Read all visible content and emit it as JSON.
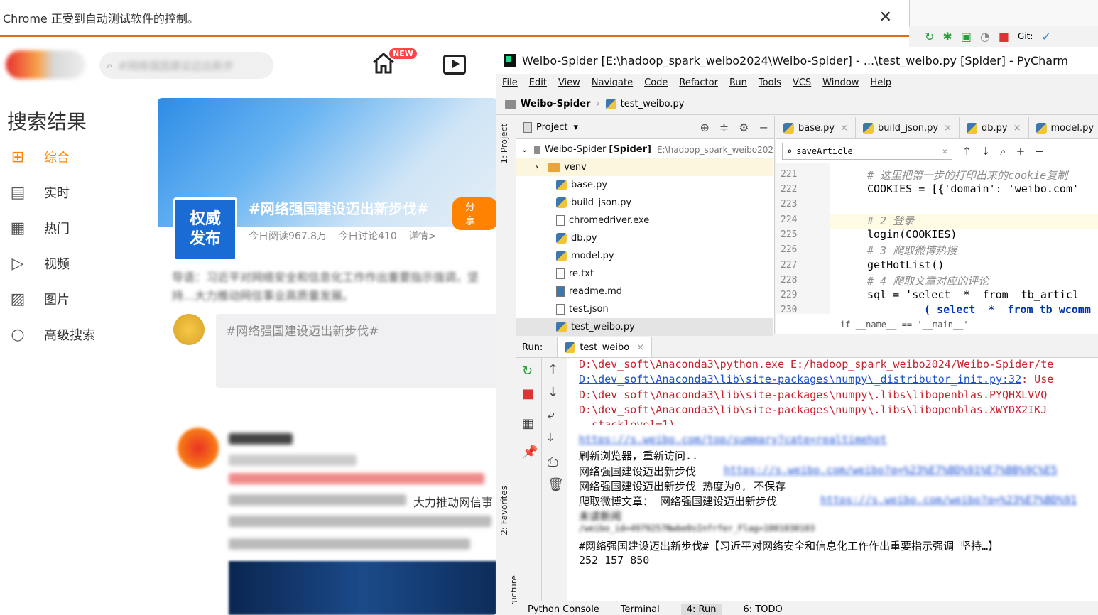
{
  "chrome": {
    "infobar_text": "Chrome 正受到自动测试软件的控制。",
    "close_glyph": "✕"
  },
  "weibo": {
    "search_placeholder": "#网络强国建设迈出新步",
    "new_badge": "NEW",
    "left_nav": {
      "title": "搜索结果",
      "items": [
        {
          "label": "综合",
          "icon": "grid-icon",
          "glyph": "⊞",
          "active": true
        },
        {
          "label": "实时",
          "icon": "chat-icon",
          "glyph": "▤"
        },
        {
          "label": "热门",
          "icon": "hot-icon",
          "glyph": "▦"
        },
        {
          "label": "视频",
          "icon": "play-circle-icon",
          "glyph": "▷"
        },
        {
          "label": "图片",
          "icon": "image-icon",
          "glyph": "▨"
        },
        {
          "label": "高级搜索",
          "icon": "search-icon",
          "glyph": "○"
        }
      ]
    },
    "topic_card": {
      "logo_text": "权威\n发布",
      "topic": "#网络强国建设迈出新步伐#",
      "share": "分享",
      "reads": "今日阅读967.8万",
      "discuss": "今日讨论410",
      "detail": "详情>",
      "lead": "导语：习近平对网络安全和信息化工作作出重要指示强调，坚持…大力推动网信事业高质量发展。",
      "post_placeholder": "#网络强国建设迈出新步伐#"
    },
    "post_card": {
      "visible_text": "大力推动网信事"
    }
  },
  "pycharm": {
    "title": "Weibo-Spider [E:\\hadoop_spark_weibo2024\\Weibo-Spider] - ...\\test_weibo.py [Spider] - PyCharm",
    "menu": [
      "File",
      "Edit",
      "View",
      "Navigate",
      "Code",
      "Refactor",
      "Run",
      "Tools",
      "VCS",
      "Window",
      "Help"
    ],
    "breadcrumb": [
      "Weibo-Spider",
      "test_weibo.py"
    ],
    "side_tabs": {
      "project": "1: Project",
      "favorites": "2: Favorites",
      "structure": "Z: Structure"
    },
    "project": {
      "header": "Project",
      "root": "Weibo-Spider",
      "root_tag": "[Spider]",
      "root_path": "E:\\hadoop_spark_weibo202",
      "files": [
        {
          "name": "venv",
          "kind": "folder"
        },
        {
          "name": "base.py",
          "kind": "py"
        },
        {
          "name": "build_json.py",
          "kind": "py"
        },
        {
          "name": "chromedriver.exe",
          "kind": "file"
        },
        {
          "name": "db.py",
          "kind": "py"
        },
        {
          "name": "model.py",
          "kind": "py"
        },
        {
          "name": "re.txt",
          "kind": "file"
        },
        {
          "name": "readme.md",
          "kind": "file"
        },
        {
          "name": "test.json",
          "kind": "file"
        },
        {
          "name": "test_weibo.py",
          "kind": "py",
          "selected": true
        }
      ]
    },
    "editor": {
      "tabs": [
        "base.py",
        "build_json.py",
        "db.py",
        "model.py"
      ],
      "find_query": "saveArticle",
      "lines": [
        {
          "n": "221",
          "text": "# 这里把第一步的打印出来的cookie复制"
        },
        {
          "n": "222",
          "text": "COOKIES = [{'domain': 'weibo.com'"
        },
        {
          "n": "223",
          "text": ""
        },
        {
          "n": "224",
          "text": "# 2 登录"
        },
        {
          "n": "225",
          "text": "login(COOKIES)"
        },
        {
          "n": "226",
          "text": "# 3 爬取微博热搜"
        },
        {
          "n": "227",
          "text": "getHotList()"
        },
        {
          "n": "228",
          "text": "# 4 爬取文章对应的评论"
        },
        {
          "n": "229",
          "text": "sql = 'select  *  from  tb_articl"
        },
        {
          "n": "230",
          "text": "  ( select  *  from tb wcomm"
        }
      ],
      "crumb": "if __name__ == '__main__'"
    },
    "run": {
      "label": "Run:",
      "tab": "test_weibo",
      "lines": [
        "D:\\dev_soft\\Anaconda3\\python.exe E:/hadoop_spark_weibo2024/Weibo-Spider/te",
        "D:\\dev_soft\\Anaconda3\\lib\\site-packages\\numpy\\_distributor_init.py:32",
        ": Use",
        "D:\\dev_soft\\Anaconda3\\lib\\site-packages\\numpy\\.libs\\libopenblas.PYQHXLVVQ",
        "D:\\dev_soft\\Anaconda3\\lib\\site-packages\\numpy\\.libs\\libopenblas.XWYDX2IKJ",
        "  stacklevel=1)",
        "https://s.weibo.com/top/summary?cate=realtimehot",
        "刷新浏览器，重新访问..",
        "网络强国建设迈出新步伐",
        "https://s.weibo.com/weibo?q=%23%E7%BD%91%E7%BB%9C%E5",
        "网络强国建设迈出新步伐 热度为0, 不保存",
        "爬取微博文章： 网络强国建设迈出新步伐",
        "https://s.weibo.com/weibo?q=%23%E7%BD%91",
        "未读新闻",
        "/weibo_id=4979257Nwbe0sInfrfer_Flag=1001030103",
        "#网络强国建设迈出新步伐#【习近平对网络安全和信息化工作作出重要指示强调 坚持…】",
        "252 157 850"
      ]
    },
    "bottom_tabs": [
      "Python Console",
      "Terminal",
      "4: Run",
      "6: TODO"
    ],
    "toolbar_vcs": "Git:"
  },
  "colors": {
    "weibo_orange": "#ff8200",
    "console_red": "#c7222d",
    "link_blue": "#1a4fd6"
  }
}
